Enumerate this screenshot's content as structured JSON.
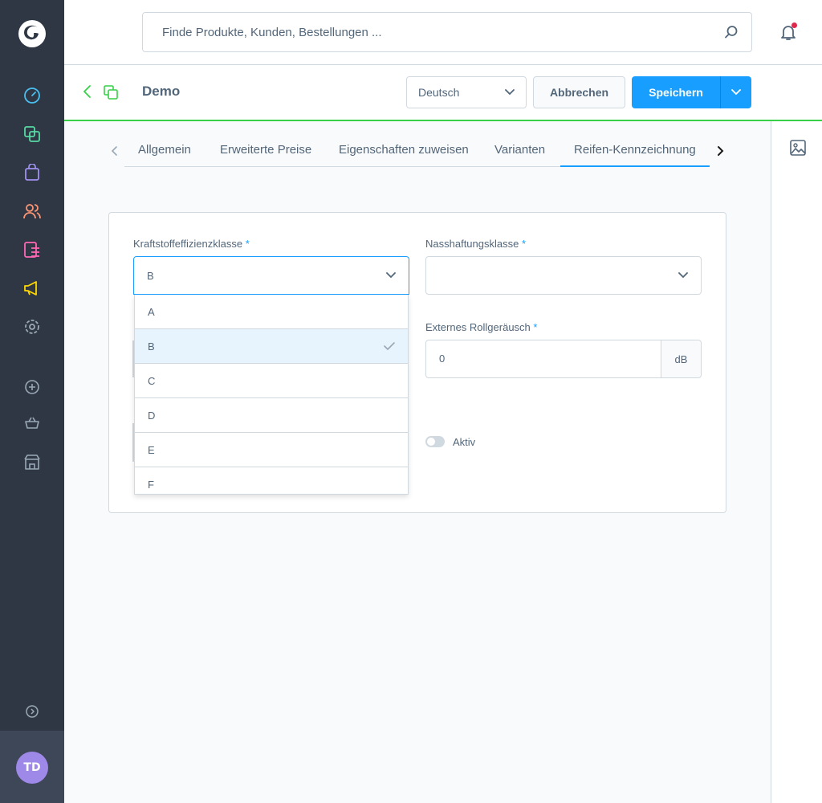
{
  "search": {
    "placeholder": "Finde Produkte, Kunden, Bestellungen ..."
  },
  "sidebar": {
    "items": [
      {
        "name": "dashboard-icon",
        "color": "#57d9a3"
      },
      {
        "name": "catalogues-icon",
        "color": "#57d9a3"
      },
      {
        "name": "orders-icon",
        "color": "#a092f0"
      },
      {
        "name": "customers-icon",
        "color": "#ff9674"
      },
      {
        "name": "content-icon",
        "color": "#ff68b4"
      },
      {
        "name": "marketing-icon",
        "color": "#ffd700"
      },
      {
        "name": "settings-icon",
        "color": "#9aa8b5"
      }
    ],
    "avatar_initials": "TD"
  },
  "smartbar": {
    "title": "Demo",
    "language": "Deutsch",
    "cancel_label": "Abbrechen",
    "save_label": "Speichern"
  },
  "tabs": [
    {
      "label": "Allgemein"
    },
    {
      "label": "Erweiterte Preise"
    },
    {
      "label": "Eigenschaften zuweisen"
    },
    {
      "label": "Varianten"
    },
    {
      "label": "Reifen-Kennzeichnung",
      "active": true
    }
  ],
  "form": {
    "fuel_label": "Kraftstoffeffizienzklasse",
    "fuel_value": "B",
    "wet_label": "Nasshaftungsklasse",
    "wet_value": "",
    "noise_label": "Externes Rollgeräusch",
    "noise_value": "0",
    "noise_unit": "dB",
    "active_label": "Aktiv",
    "required_mark": "*"
  },
  "dropdown": {
    "options": [
      "A",
      "B",
      "C",
      "D",
      "E",
      "F"
    ],
    "selected": "B"
  },
  "colors": {
    "accent": "#189eff",
    "sidebar": "#2f3744",
    "success": "#37d046"
  }
}
